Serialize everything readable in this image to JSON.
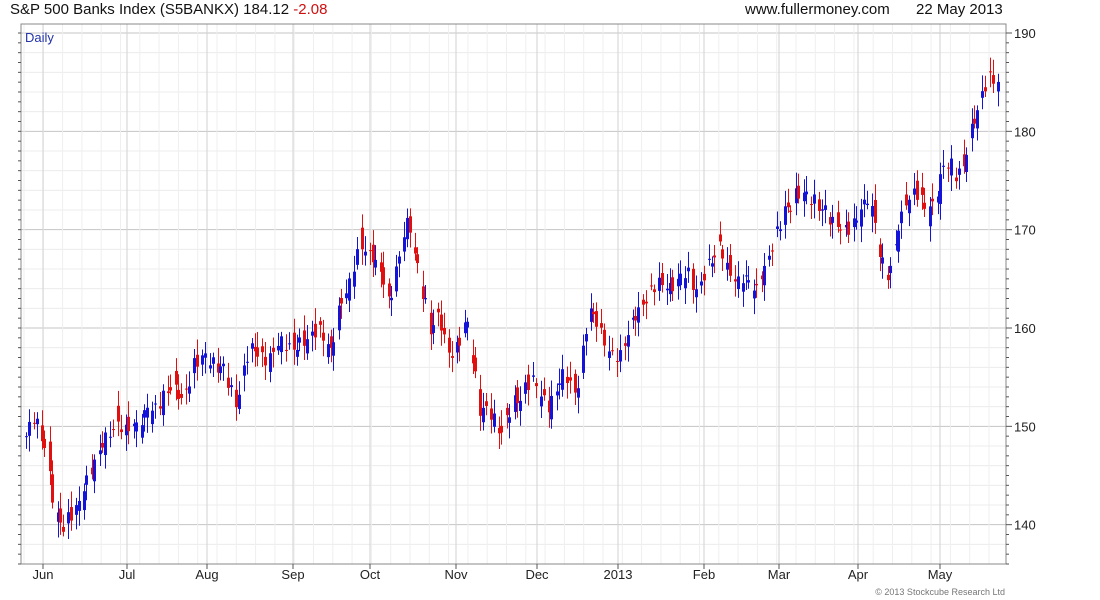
{
  "header": {
    "title": "S&P 500 Banks Index (S5BANKX) 184.12",
    "change": "-2.08",
    "website": "www.fullermoney.com",
    "date": "22 May 2013"
  },
  "period_label": "Daily",
  "copyright": "© 2013 Stockcube Research Ltd",
  "colors": {
    "up": "#1414d8",
    "down": "#e01010",
    "grid": "#c8c8c8"
  },
  "chart_data": {
    "type": "candlestick",
    "title": "S&P 500 Banks Index (S5BANKX) 184.12",
    "ylim": [
      136,
      190
    ],
    "y_ticks": [
      140,
      150,
      160,
      170,
      180,
      190
    ],
    "x_ticks": [
      "Jun",
      "Jul",
      "Aug",
      "Sep",
      "Oct",
      "Nov",
      "Dec",
      "2013",
      "Feb",
      "Mar",
      "Apr",
      "May"
    ],
    "grid": true,
    "y_axis_side": "right",
    "series": [
      {
        "values_approx": [
          {
            "month": "Jun 2012",
            "close_range": [
              139,
              153
            ]
          },
          {
            "month": "Jul 2012",
            "close_range": [
              151,
              159
            ]
          },
          {
            "month": "Aug 2012",
            "close_range": [
              154,
              160
            ]
          },
          {
            "month": "Sep 2012",
            "close_range": [
              158,
              171
            ]
          },
          {
            "month": "Oct 2012",
            "close_range": [
              156,
              170
            ]
          },
          {
            "month": "Nov 2012",
            "close_range": [
              147,
              160
            ]
          },
          {
            "month": "Dec 2012",
            "close_range": [
              151,
              161
            ]
          },
          {
            "month": "Jan 2013",
            "close_range": [
              158,
              166
            ]
          },
          {
            "month": "Feb 2013",
            "close_range": [
              163,
              168
            ]
          },
          {
            "month": "Mar 2013",
            "close_range": [
              163,
              175
            ]
          },
          {
            "month": "Apr 2013",
            "close_range": [
              166,
              174
            ]
          },
          {
            "month": "May 2013",
            "close_range": [
              172,
              186
            ]
          }
        ]
      }
    ],
    "last_close": 184.12
  }
}
